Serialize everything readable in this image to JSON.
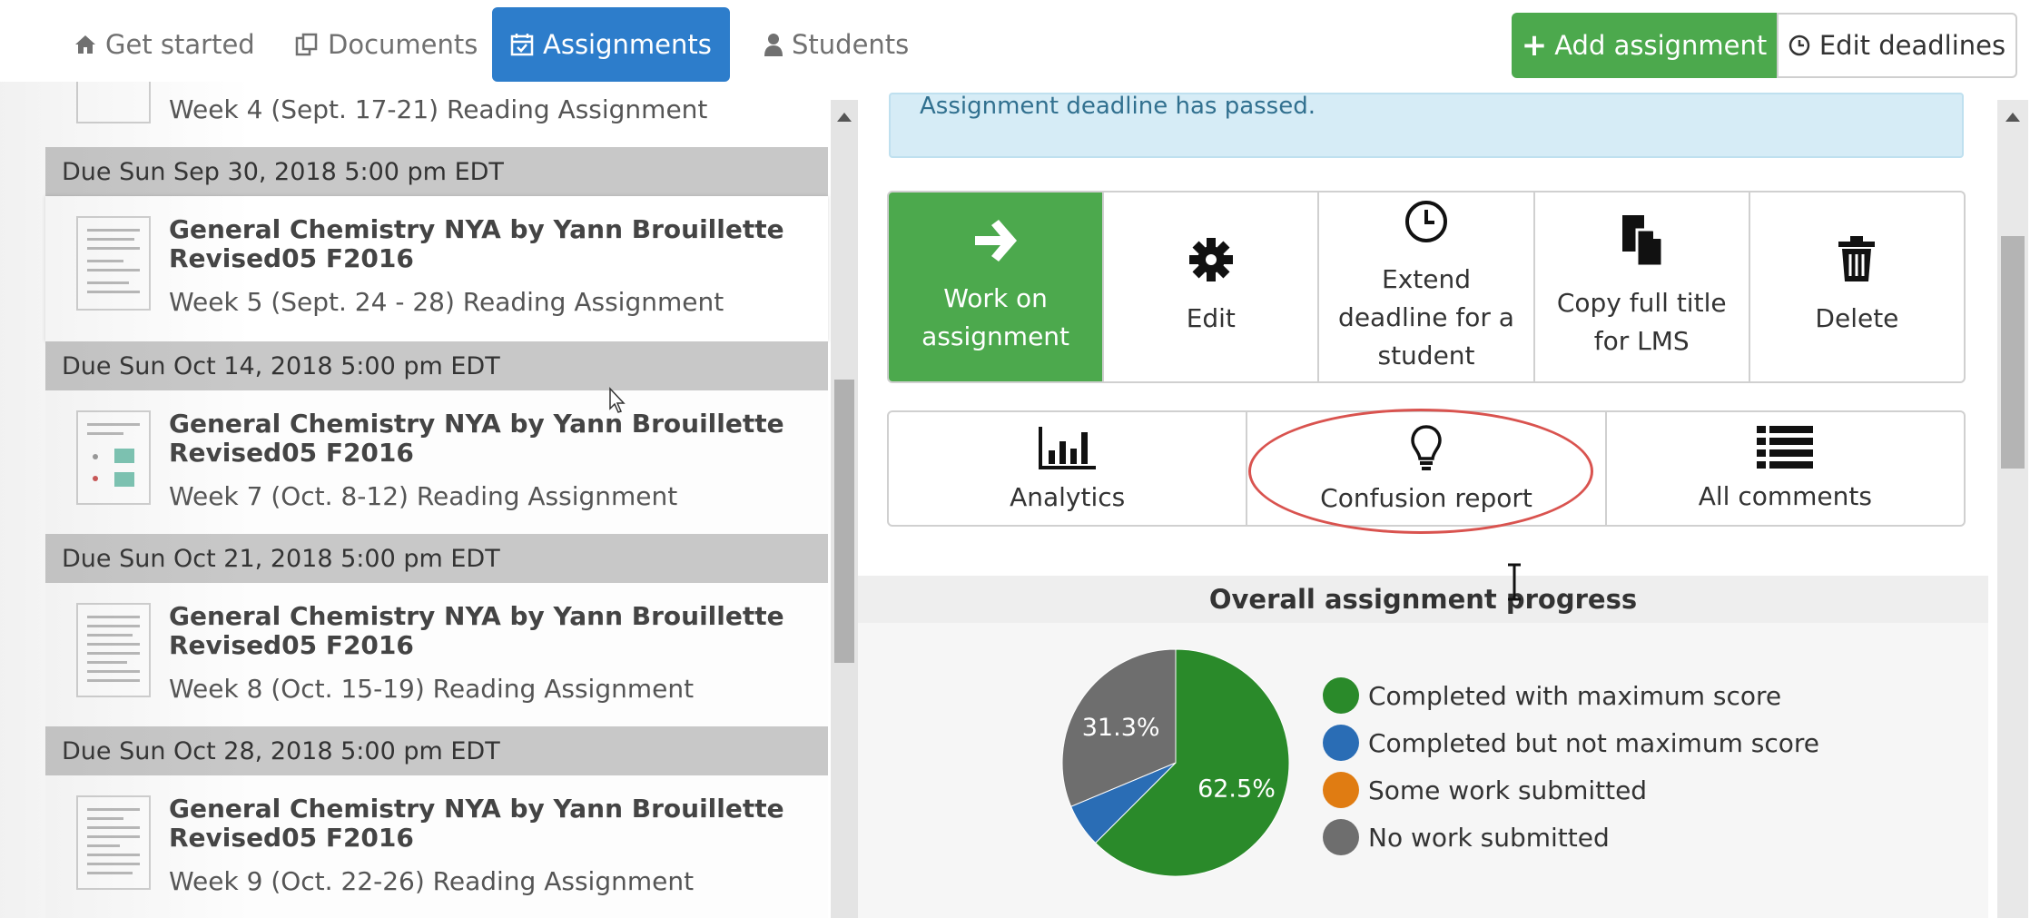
{
  "nav": {
    "tabs": [
      {
        "label": "Get started",
        "icon": "home-icon"
      },
      {
        "label": "Documents",
        "icon": "documents-icon"
      },
      {
        "label": "Assignments",
        "icon": "calendar-check-icon",
        "active": true
      },
      {
        "label": "Students",
        "icon": "user-icon"
      }
    ],
    "add_assignment": "Add assignment",
    "edit_deadlines": "Edit deadlines"
  },
  "list": {
    "top_partial": "Week 4 (Sept. 17-21) Reading Assignment",
    "groups": [
      {
        "due": "Due Sun Sep 30, 2018 5:00 pm EDT",
        "title1": "General Chemistry NYA by Yann Brouillette",
        "title2": "Revised05 F2016",
        "subtitle": "Week 5 (Sept. 24 - 28) Reading Assignment",
        "selected": true
      },
      {
        "due": "Due Sun Oct 14, 2018 5:00 pm EDT",
        "title1": "General Chemistry NYA by Yann Brouillette",
        "title2": "Revised05 F2016",
        "subtitle": "Week 7 (Oct. 8-12) Reading Assignment"
      },
      {
        "due": "Due Sun Oct 21, 2018 5:00 pm EDT",
        "title1": "General Chemistry NYA by Yann Brouillette",
        "title2": "Revised05 F2016",
        "subtitle": "Week 8 (Oct. 15-19) Reading Assignment"
      },
      {
        "due": "Due Sun Oct 28, 2018 5:00 pm EDT",
        "title1": "General Chemistry NYA by Yann Brouillette",
        "title2": "Revised05 F2016",
        "subtitle": "Week 9 (Oct. 22-26) Reading Assignment"
      }
    ]
  },
  "detail": {
    "alert": "Assignment deadline has passed.",
    "actions": {
      "work_line1": "Work on",
      "work_line2": "assignment",
      "edit": "Edit",
      "extend_line1": "Extend",
      "extend_line2": "deadline for a",
      "extend_line3": "student",
      "copy_line1": "Copy full title",
      "copy_line2": "for LMS",
      "delete": "Delete"
    },
    "reports": {
      "analytics": "Analytics",
      "confusion": "Confusion report",
      "comments": "All comments"
    },
    "progress_title": "Overall assignment progress"
  },
  "chart_data": {
    "type": "pie",
    "values": [
      62.5,
      6.2,
      0,
      31.3
    ],
    "labels": [
      "Completed with maximum score",
      "Completed but not maximum score",
      "Some work submitted",
      "No work submitted"
    ],
    "colors": [
      "#2a8a2a",
      "#2a6db5",
      "#e07c12",
      "#6e6e6e"
    ],
    "data_labels": [
      "62.5%",
      "",
      "",
      "31.3%"
    ],
    "legend_position": "right"
  }
}
